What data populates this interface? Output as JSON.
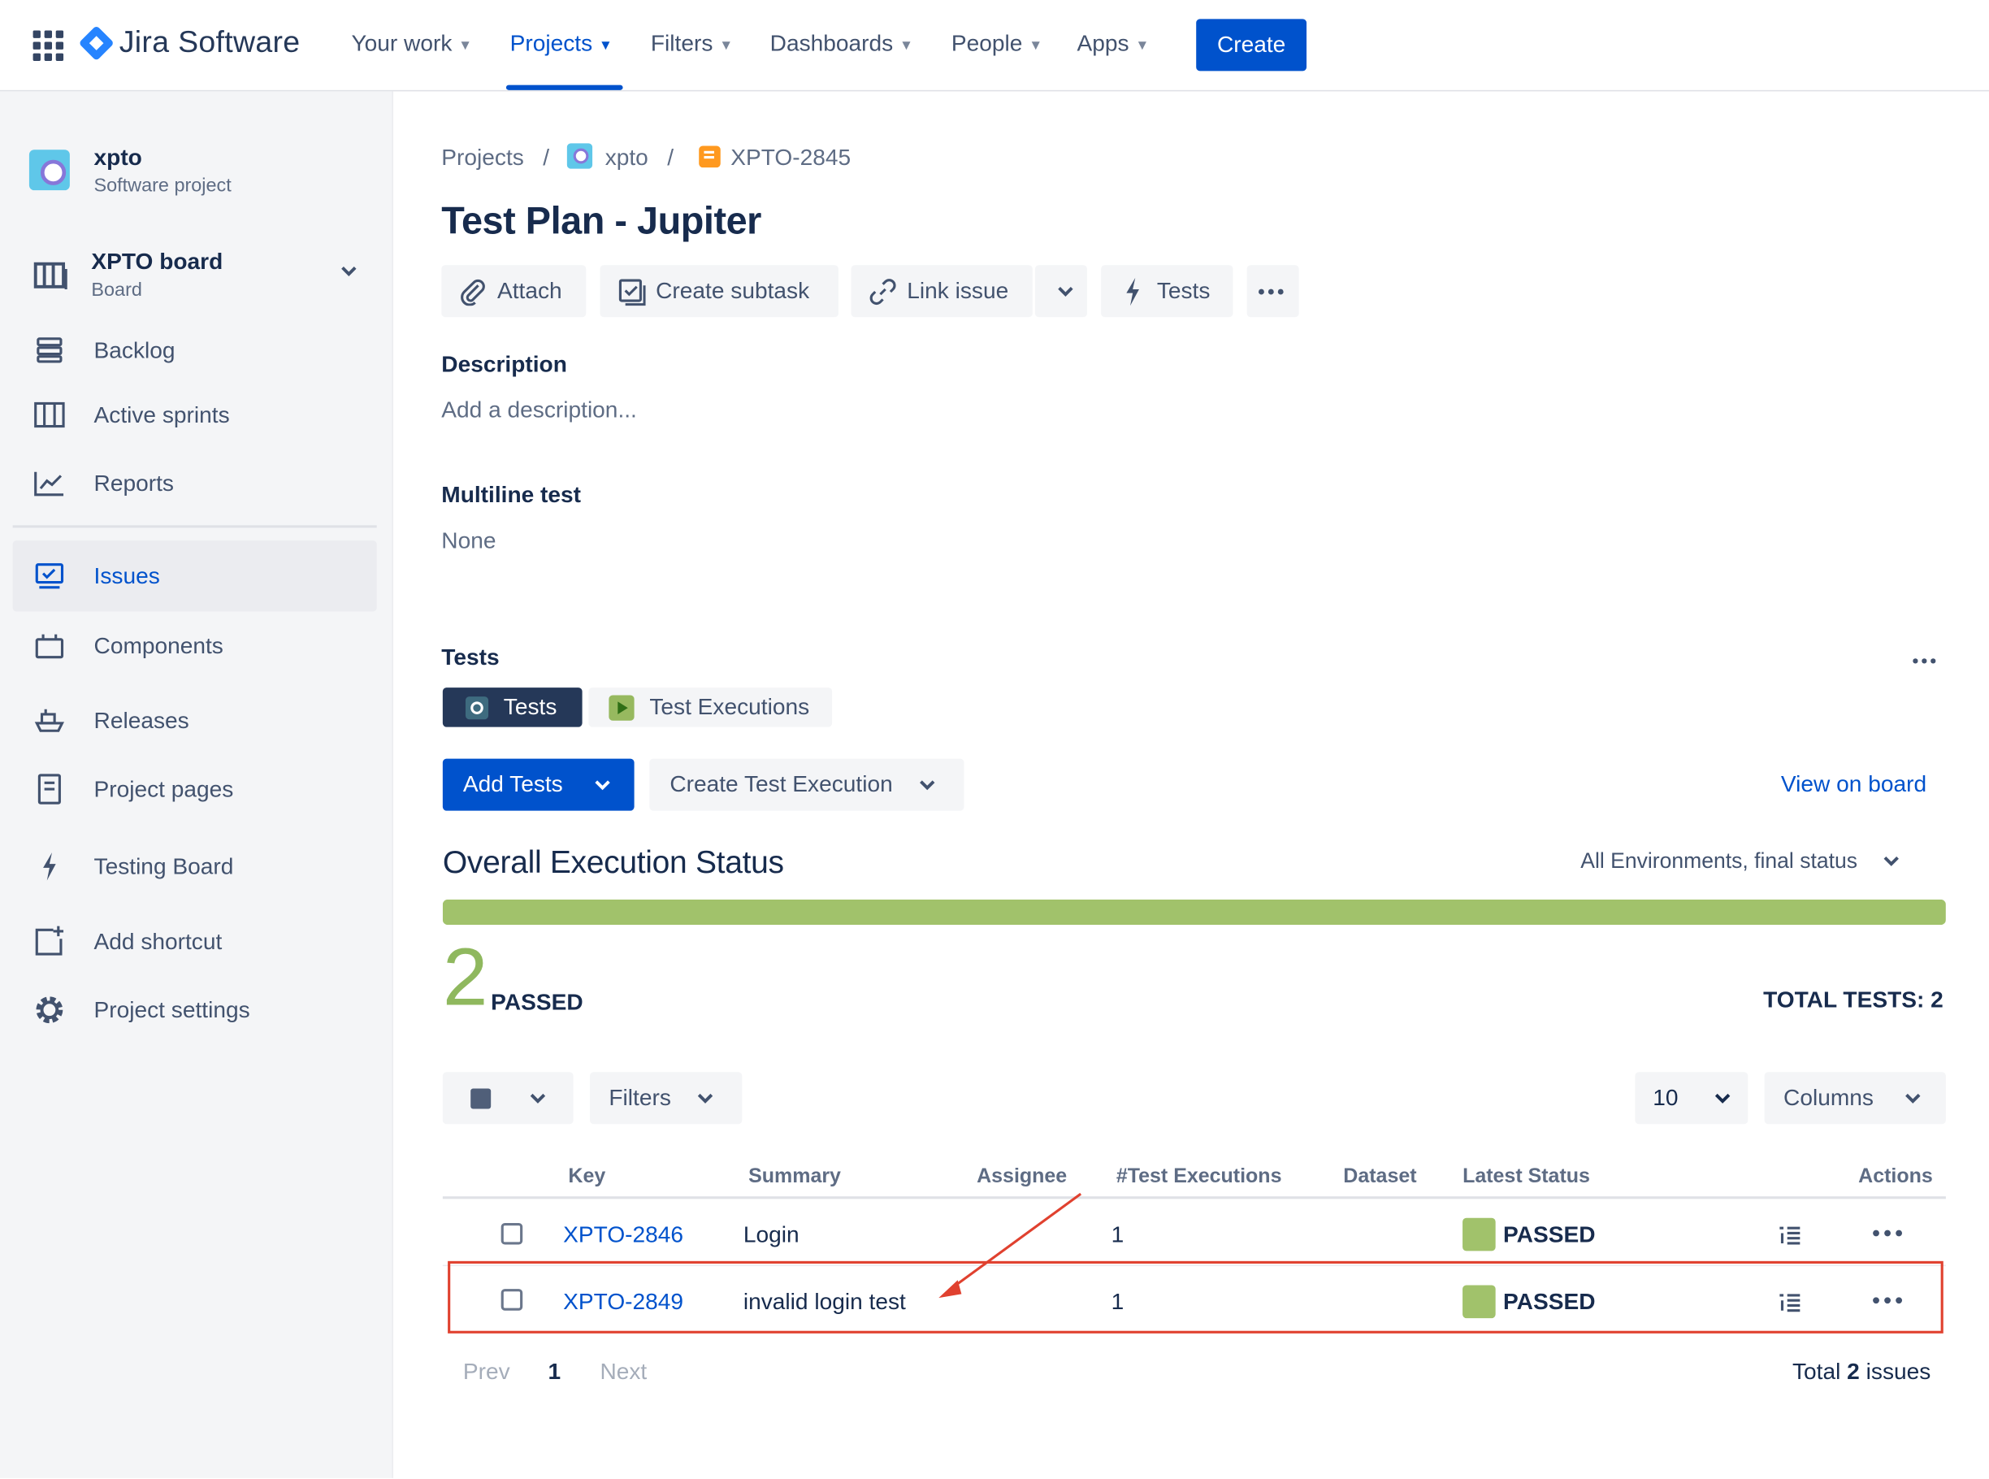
{
  "topnav": {
    "product": "Jira Software",
    "items": [
      {
        "label": "Your work"
      },
      {
        "label": "Projects"
      },
      {
        "label": "Filters"
      },
      {
        "label": "Dashboards"
      },
      {
        "label": "People"
      },
      {
        "label": "Apps"
      }
    ],
    "active": "Projects",
    "create_label": "Create"
  },
  "sidebar": {
    "project_name": "xpto",
    "project_type": "Software project",
    "board_title": "XPTO board",
    "board_sub": "Board",
    "items": [
      {
        "label": "Backlog",
        "icon": "backlog-icon"
      },
      {
        "label": "Active sprints",
        "icon": "sprints-icon"
      },
      {
        "label": "Reports",
        "icon": "reports-icon"
      },
      {
        "label": "Issues",
        "icon": "issues-icon",
        "selected": true
      },
      {
        "label": "Components",
        "icon": "components-icon"
      },
      {
        "label": "Releases",
        "icon": "releases-icon"
      },
      {
        "label": "Project pages",
        "icon": "pages-icon"
      },
      {
        "label": "Testing Board",
        "icon": "lightning-icon"
      },
      {
        "label": "Add shortcut",
        "icon": "add-shortcut-icon"
      },
      {
        "label": "Project settings",
        "icon": "gear-icon"
      }
    ]
  },
  "breadcrumb": {
    "projects": "Projects",
    "sep": "/",
    "project": "xpto",
    "issue": "XPTO-2845"
  },
  "issue": {
    "title": "Test Plan - Jupiter",
    "toolbar": {
      "attach": "Attach",
      "subtask": "Create subtask",
      "link": "Link issue",
      "tests": "Tests"
    },
    "description_label": "Description",
    "description_placeholder": "Add a description...",
    "multiline_label": "Multiline test",
    "multiline_value": "None"
  },
  "tests_panel": {
    "title": "Tests",
    "tabs": {
      "tests": "Tests",
      "executions": "Test Executions"
    },
    "add_tests": "Add Tests",
    "create_execution": "Create Test Execution",
    "view_on_board": "View on board",
    "overall_title": "Overall Execution Status",
    "env_filter": "All Environments, final status",
    "passed_fraction": 1.0,
    "passed_count": "2",
    "passed_label": "PASSED",
    "total_tests": "TOTAL TESTS: 2",
    "filters_label": "Filters",
    "page_size": "10",
    "columns_label": "Columns",
    "status_color": "#a1c26b",
    "table": {
      "headers": [
        "Key",
        "Summary",
        "Assignee",
        "#Test Executions",
        "Dataset",
        "Latest Status",
        "Actions"
      ],
      "rows": [
        {
          "key": "XPTO-2846",
          "summary": "Login",
          "assignee": "",
          "executions": "1",
          "dataset": "",
          "status": "PASSED"
        },
        {
          "key": "XPTO-2849",
          "summary": "invalid login test",
          "assignee": "",
          "executions": "1",
          "dataset": "",
          "status": "PASSED"
        }
      ]
    },
    "pagination": {
      "prev": "Prev",
      "current": "1",
      "next": "Next",
      "total_prefix": "Total",
      "total_count": "2",
      "total_suffix": "issues"
    }
  },
  "annotation_color": "#e0412f"
}
